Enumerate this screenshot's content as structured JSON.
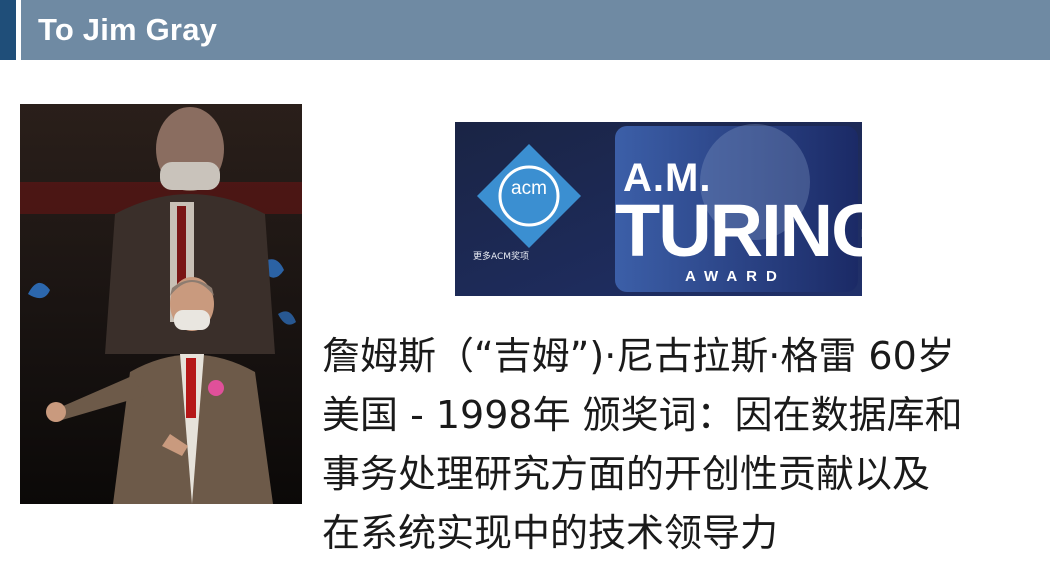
{
  "header": {
    "title": "To Jim Gray",
    "accent_color": "#1f4e79",
    "bar_color": "#6f8aa3"
  },
  "photo": {
    "icon": "portrait-photo"
  },
  "award_image": {
    "logo_text": "acm",
    "link_text": "更多ACM奖项",
    "am_text": "A.M.",
    "turing_text": "TURING",
    "award_text": "AWARD",
    "background_color": "#1d2746",
    "logo_color": "#3b8fd1"
  },
  "caption": {
    "lines": [
      "詹姆斯（“吉姆”)·尼古拉斯·格雷 60岁",
      "美国 - 1998年 颁奖词：因在数据库和",
      "事务处理研究方面的开创性贡献以及",
      "在系统实现中的技术领导力"
    ]
  }
}
